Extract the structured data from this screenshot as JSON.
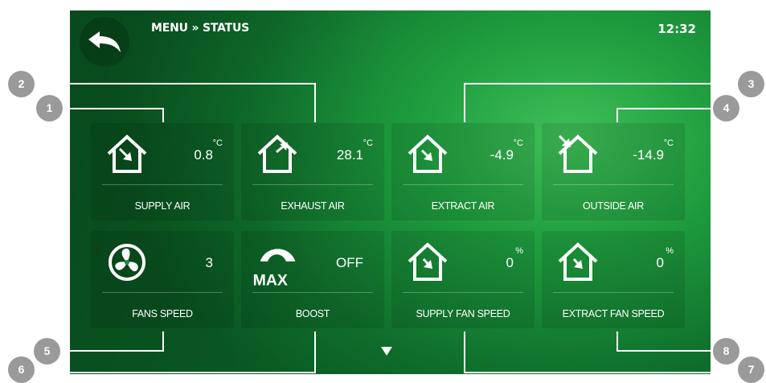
{
  "header": {
    "breadcrumb": "MENU » STATUS",
    "time": "12:32"
  },
  "tiles": [
    {
      "label": "SUPPLY AIR",
      "value": "0.8",
      "unit": "°C",
      "icon": "house-arrow-in-icon"
    },
    {
      "label": "EXHAUST AIR",
      "value": "28.1",
      "unit": "°C",
      "icon": "house-arrow-out-icon"
    },
    {
      "label": "EXTRACT AIR",
      "value": "-4.9",
      "unit": "°C",
      "icon": "house-arrow-in-icon"
    },
    {
      "label": "OUTSIDE AIR",
      "value": "-14.9",
      "unit": "°C",
      "icon": "house-arrow-outside-icon"
    },
    {
      "label": "FANS SPEED",
      "value": "3",
      "unit": "",
      "icon": "fan-icon"
    },
    {
      "label": "BOOST",
      "value": "OFF",
      "unit": "",
      "icon": "boost-max-icon",
      "icon_text": "MAX"
    },
    {
      "label": "SUPPLY FAN SPEED",
      "value": "0",
      "unit": "%",
      "icon": "house-arrow-in-icon"
    },
    {
      "label": "EXTRACT FAN SPEED",
      "value": "0",
      "unit": "%",
      "icon": "house-arrow-in-icon"
    }
  ],
  "callouts": [
    "1",
    "2",
    "3",
    "4",
    "5",
    "6",
    "7",
    "8"
  ],
  "colors": {
    "badge": "#9a9a9a",
    "screen": "#1e9c3e"
  }
}
